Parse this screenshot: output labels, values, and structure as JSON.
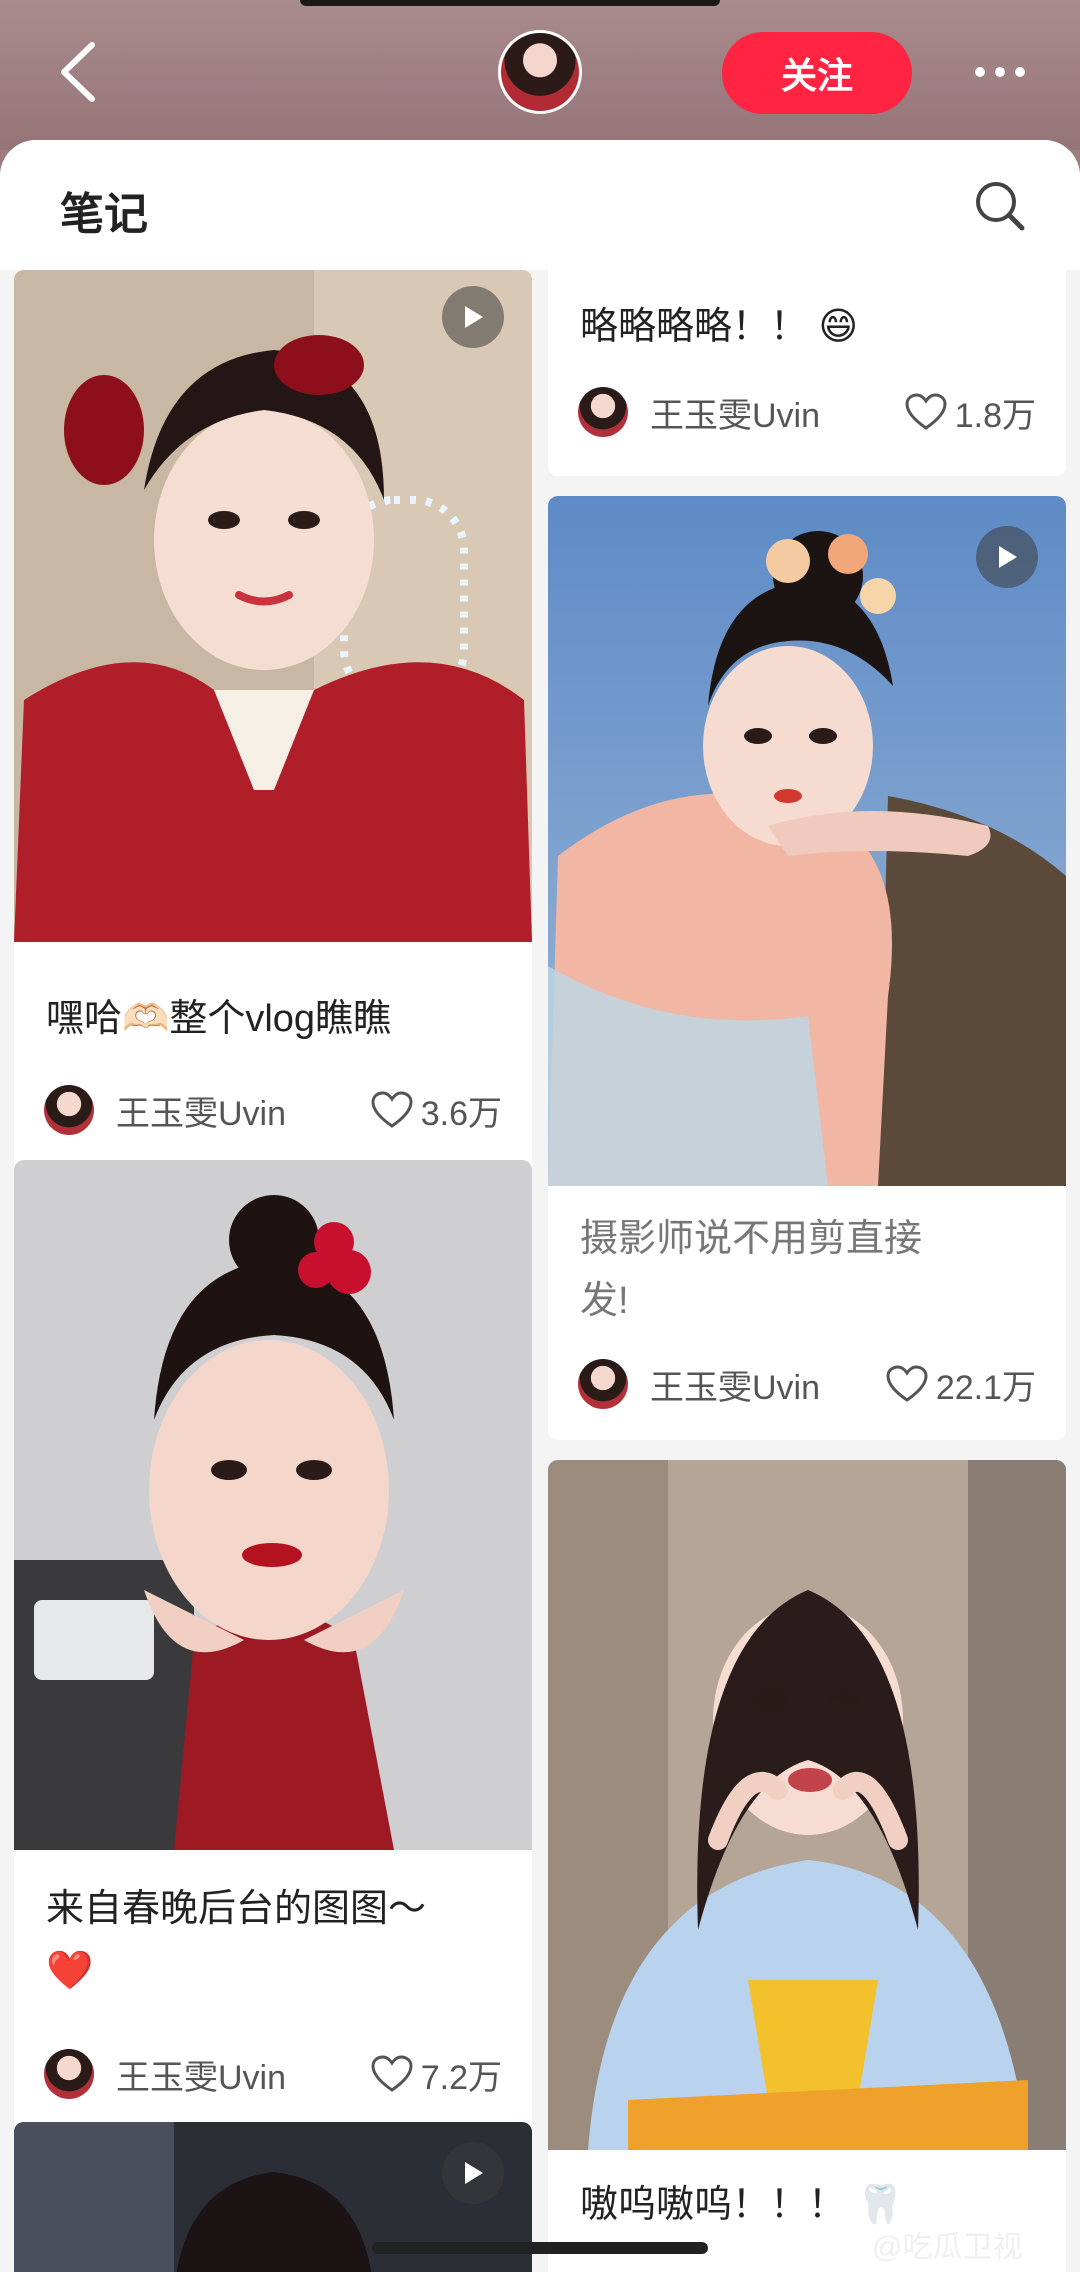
{
  "header": {
    "follow_label": "关注"
  },
  "sheet": {
    "title": "笔记"
  },
  "notes": [
    {
      "id": "a",
      "title": "略略略略！！ 😄",
      "author": "王玉雯Uvin",
      "likes": "1.8万"
    },
    {
      "id": "b",
      "title": "嘿哈🫶🏻整个vlog瞧瞧",
      "author": "王玉雯Uvin",
      "likes": "3.6万",
      "video": true
    },
    {
      "id": "c",
      "title": "摄影师说不用剪直接\n发!",
      "author": "王玉雯Uvin",
      "likes": "22.1万",
      "video": true
    },
    {
      "id": "d",
      "title": "来自春晚后台的图图～\n❤️",
      "author": "王玉雯Uvin",
      "likes": "7.2万"
    },
    {
      "id": "e",
      "title": "嗷呜嗷呜！！！ 🦷",
      "author": "",
      "likes": ""
    }
  ],
  "watermark": "@吃瓜卫视"
}
